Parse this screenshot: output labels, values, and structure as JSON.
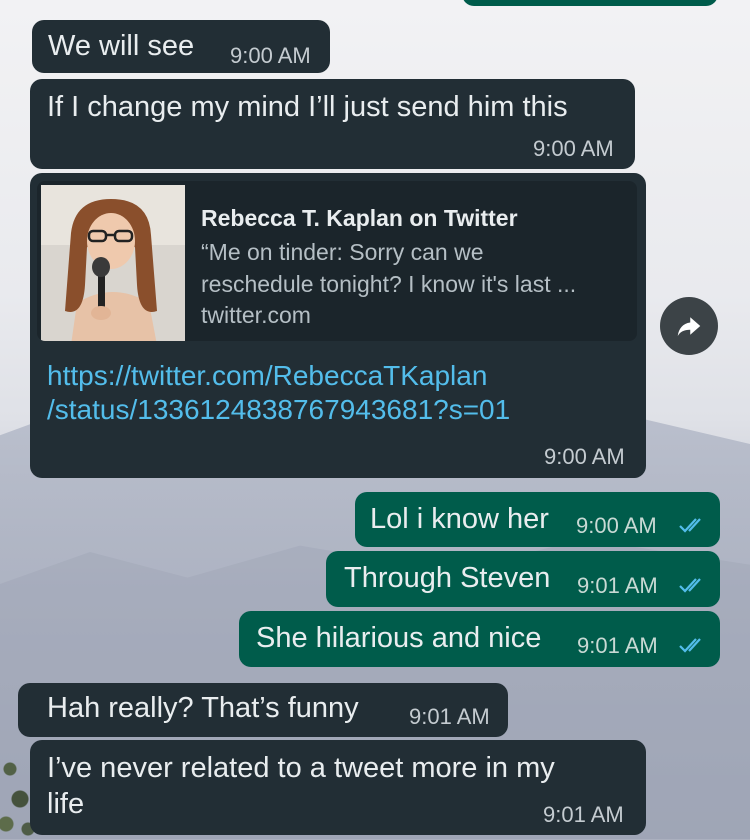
{
  "messages": [
    {
      "dir": "in",
      "text": "We will see",
      "time": "9:00 AM"
    },
    {
      "dir": "in",
      "text": "If I change my mind I’ll just send him this",
      "time": "9:00 AM"
    },
    {
      "dir": "in",
      "time": "9:00 AM",
      "link_preview": {
        "title": "Rebecca T. Kaplan on Twitter",
        "desc_line1": "“Me on tinder: Sorry can we",
        "desc_line2": "reschedule tonight? I know it's last ...",
        "domain": "twitter.com"
      },
      "url_line1": "https://twitter.com/RebeccaTKaplan",
      "url_line2": "/status/1336124838767943681?s=01"
    },
    {
      "dir": "out",
      "text": "Lol i know her",
      "time": "9:00 AM",
      "status": "read"
    },
    {
      "dir": "out",
      "text": "Through Steven",
      "time": "9:01 AM",
      "status": "read"
    },
    {
      "dir": "out",
      "text": "She hilarious and nice",
      "time": "9:01 AM",
      "status": "read"
    },
    {
      "dir": "in",
      "text": "Hah really? That’s funny",
      "time": "9:01 AM"
    },
    {
      "dir": "in",
      "text_line1": "I’ve never related to a tweet more in my",
      "text_line2": "life",
      "time": "9:01 AM"
    }
  ],
  "icons": {
    "share": "forward-arrow-icon",
    "read": "double-check-icon"
  },
  "colors": {
    "incoming": "#222e35",
    "outgoing": "#005c4b",
    "link": "#53bdeb",
    "read_tick": "#53bdeb"
  }
}
